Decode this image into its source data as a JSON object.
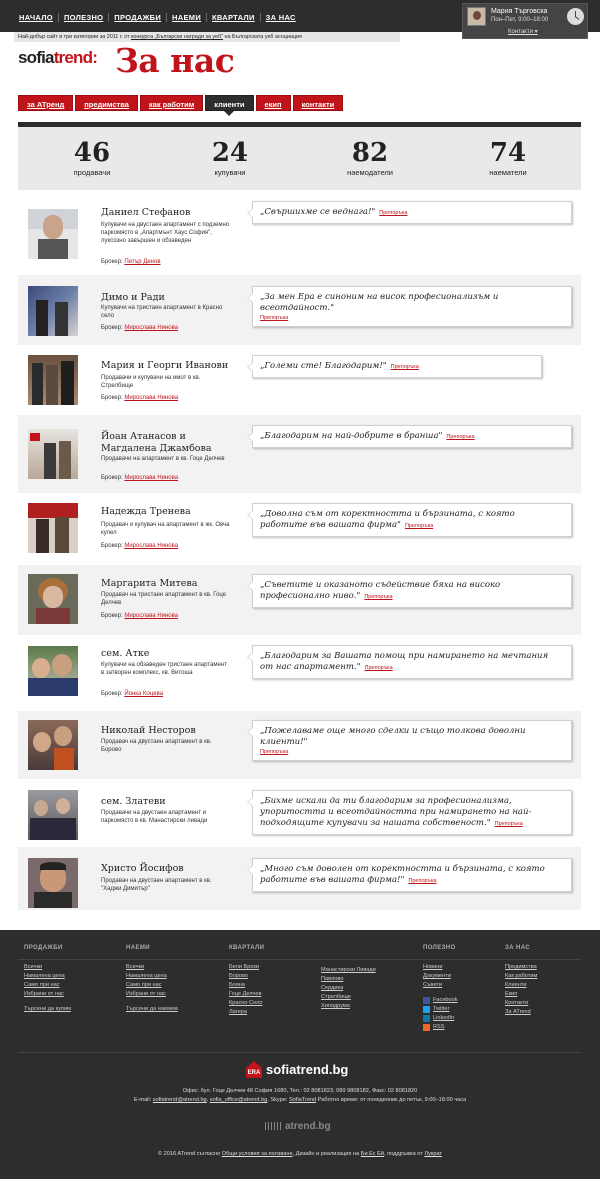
{
  "top_nav": [
    "НАЧАЛО",
    "ПОЛЕЗНО",
    "ПРОДАЖБИ",
    "НАЕМИ",
    "КВАРТАЛИ",
    "ЗА НАС"
  ],
  "agent": {
    "name": "Мария Търговска",
    "hours": "Пон–Пет, 9:00–18:00",
    "contact_label": "Контакти"
  },
  "award": {
    "prefix": "Най-добър сайт в три категории за 2011 г. от ",
    "link": "конкурса „Български награди за уеб\"",
    "suffix": " на Българската уеб асоциация"
  },
  "logo": {
    "sofia": "sofia",
    "trend": "trend:"
  },
  "page_title": "За нас",
  "tabs": [
    {
      "label": "за АТренд",
      "active": false
    },
    {
      "label": "предимства",
      "active": false
    },
    {
      "label": "как работим",
      "active": false
    },
    {
      "label": "клиенти",
      "active": true
    },
    {
      "label": "екип",
      "active": false
    },
    {
      "label": "контакти",
      "active": false
    }
  ],
  "stats": [
    {
      "value": "46",
      "label": "продавачи"
    },
    {
      "value": "24",
      "label": "купувачи"
    },
    {
      "value": "82",
      "label": "наемодатели"
    },
    {
      "value": "74",
      "label": "наематели"
    }
  ],
  "broker_prefix": "Брокер:",
  "recommend_label": "Препоръка",
  "testimonials": [
    {
      "name": "Даниел Стефанов",
      "desc": "Купувачи на двустаен апартамент с подземно паркомясто в „Апартмънт Хаус София\", луксозно завършен и обзаведен",
      "broker": "Петър Денов",
      "quote": "„Свършихме се веднага!\""
    },
    {
      "name": "Димо и Ради",
      "desc": "Купувачи на тристаен апартамент в Красно село",
      "broker": "Мирослава Нинова",
      "quote": "„За мен Ера е синоним на висок професионализъм и всеотдайност.\""
    },
    {
      "name": "Мария и Георги Иванови",
      "desc": "Продавачи и купувачи на имот в кв. Стрелбище",
      "broker": "Мирослава Нинова",
      "quote": "„Големи сте! Благодарим!\""
    },
    {
      "name": "Йоан Атанасов и Магдалена Джамбова",
      "desc": "Продавачи на апартамент в кв. Гоце Делчев",
      "broker": "Мирослава Нинова",
      "quote": "„Благодарим на най-добрите в бранша\""
    },
    {
      "name": "Надежда Тренева",
      "desc": "Продавач и купувач на апартамент в жк. Овча купел",
      "broker": "Мирослава Нинова",
      "quote": "„Доволна съм от коректността и бързината, с която работите във вашата фирма\""
    },
    {
      "name": "Маргарита Митева",
      "desc": "Продавач на тристаен апартамент в кв. Гоце Делчев",
      "broker": "Мирослава Нинова",
      "quote": "„Съветите и оказаното съдействие бяха на високо професионално ниво.\""
    },
    {
      "name": "сем. Атке",
      "desc": "Купувачи на обзаведен тристаен апартамент в затворен комплекс, кв. Витоша",
      "broker": "Йонка Коцева",
      "quote": "„Благодарим за Вашата помощ при намирането на мечтания от нас апартамент.\""
    },
    {
      "name": "Николай Несторов",
      "desc": "Продавач на двустаен апартамент в кв. Борово",
      "broker": "",
      "quote": "„Пожелаваме още много сделки и също толкова доволни клиенти!\""
    },
    {
      "name": "сем. Златеви",
      "desc": "Продавачи на двустаен апартамент и паркомясто в кв. Манастирски ливади",
      "broker": "",
      "quote": "„Бихме искали да ти благодарим за професионализма, упоритостта и всеотдайността при намирането на най-подходящите купувачи за нашата собственост.\""
    },
    {
      "name": "Христо Йосифов",
      "desc": "Продавач на двустаен апартамент в кв. \"Хаджи Димитър\"",
      "broker": "",
      "quote": "„Много съм доволен от коректността и бързината, с която работите във вашата фирма!\""
    }
  ],
  "footer": {
    "columns": [
      {
        "title": "ПРОДАЖБИ",
        "links": [
          "Всички",
          "Намалена цена",
          "Само при нас",
          "Избрани от нас",
          "",
          "Търсени да купим"
        ]
      },
      {
        "title": "НАЕМИ",
        "links": [
          "Всички",
          "Намалена цена",
          "Само при нас",
          "Избрани от нас",
          "",
          "Търсени да наемем"
        ]
      },
      {
        "title": "КВАРТАЛИ",
        "links": [
          "Бели Брези",
          "Борово",
          "Бояна",
          "Гоце Делчев",
          "Красно Село",
          "Лагера"
        ]
      },
      {
        "title": "",
        "links": [
          "Манастирски Ливади",
          "Павлово",
          "Сердика",
          "Стрелбище",
          "Хиподрума"
        ]
      },
      {
        "title": "ПОЛЕЗНО",
        "links": [
          "Новини",
          "Документи",
          "Съвети"
        ]
      },
      {
        "title": "ЗА НАС",
        "links": [
          "Предимства",
          "Как работим",
          "Клиенти",
          "Екип",
          "Контакти",
          "За ATrend"
        ]
      }
    ],
    "social": [
      "Facebook",
      "Twitter",
      "LinkedIn",
      "RSS"
    ],
    "brand": "sofiatrend.bg",
    "era_label": "ERA",
    "office": "Офис: бул. Гоце Делчев 48 София 1680, Тел.: 02 8081823, 089 9808182, Факс: 02 8081820",
    "email_prefix": "E-mail: ",
    "email1": "sofiatrend@atrend.bg",
    "email2": "sofia_office@atrend.bg",
    "skype_prefix": ", Skype: ",
    "skype": "SofiaTrend",
    "hours": " Работно време: от понеделник до петък, 9:00–18:00 часа",
    "atrend": "atrend.bg",
    "copy_prefix": "© 2016 ATrend съгласно ",
    "terms": "Общи условия за ползване",
    "copy_mid": ", Дизайн и реализация на ",
    "designer": "Би Ес Ей",
    "copy_mid2": ", поддръжка от ",
    "support": "Лукрат"
  },
  "colors": {
    "accent": "#c0141a",
    "dark": "#2d2d2d"
  }
}
